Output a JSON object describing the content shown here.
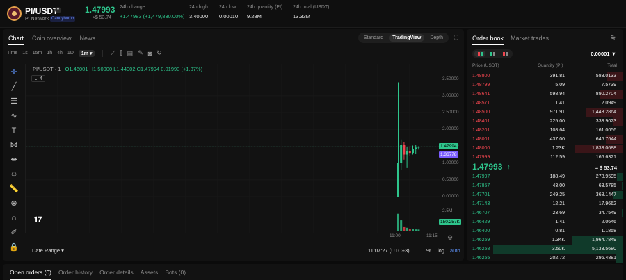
{
  "header": {
    "pair": "PI/USDT",
    "network": "PI Network",
    "network_tag": "Candybomb",
    "price": "1.47993",
    "fiat": "≈$ 53.74",
    "stats": [
      {
        "label": "24h change",
        "value": "+1.47983 (+1,479,830.00%)",
        "up": true
      },
      {
        "label": "24h high",
        "value": "3.40000"
      },
      {
        "label": "24h low",
        "value": "0.00010"
      },
      {
        "label": "24h quantity (PI)",
        "value": "9.28M"
      },
      {
        "label": "24h total (USDT)",
        "value": "13.33M"
      }
    ]
  },
  "chart_tabs": [
    "Chart",
    "Coin overview",
    "News"
  ],
  "view_modes": [
    "Standard",
    "TradingView",
    "Depth"
  ],
  "active_view": "TradingView",
  "timeframes": [
    "Time",
    "1s",
    "15m",
    "1h",
    "4h",
    "1D",
    "1m"
  ],
  "active_timeframe": "1m",
  "legend": {
    "symbol": "PI/USDT · 1",
    "open": "O1.46001",
    "high": "H1.50000",
    "low": "L1.44002",
    "close": "C1.47994",
    "change": "0.01993 (+1.37%)",
    "collapsed_count": "4"
  },
  "price_axis": [
    "3.50000",
    "3.00000",
    "2.50000",
    "2.00000",
    "1.50000",
    "1.00000",
    "0.50000",
    "0.00000"
  ],
  "volume_axis": [
    "2.5M"
  ],
  "price_tags": {
    "last": "1.47994",
    "mark": "1.36778",
    "volume": "150.257K"
  },
  "time_axis": [
    "11:00",
    "11:15"
  ],
  "bottom_bar": {
    "date_range": "Date Range",
    "clock": "11:07:27 (UTC+3)",
    "percent": "%",
    "log": "log",
    "auto": "auto"
  },
  "chart_data": {
    "type": "candlestick",
    "ylim": [
      0,
      3.7
    ],
    "candles": [
      {
        "o": 0.0001,
        "h": 3.4,
        "l": 0.0001,
        "c": 1.0
      },
      {
        "o": 1.0,
        "h": 1.7,
        "l": 0.8,
        "c": 1.55
      },
      {
        "o": 1.55,
        "h": 1.62,
        "l": 1.1,
        "c": 1.25
      },
      {
        "o": 1.25,
        "h": 1.48,
        "l": 0.85,
        "c": 1.35
      },
      {
        "o": 1.35,
        "h": 1.5,
        "l": 1.2,
        "c": 1.3
      },
      {
        "o": 1.3,
        "h": 1.52,
        "l": 1.25,
        "c": 1.42
      },
      {
        "o": 1.42,
        "h": 1.55,
        "l": 1.28,
        "c": 1.46
      },
      {
        "o": 1.46,
        "h": 1.5,
        "l": 1.4,
        "c": 1.48
      }
    ],
    "volumes": [
      2.6,
      1.6,
      0.65,
      0.45,
      0.25,
      0.3,
      0.2,
      0.18
    ],
    "volume_max": 3.0
  },
  "orderbook": {
    "tabs": [
      "Order book",
      "Market trades"
    ],
    "precision": "0.00001",
    "columns": [
      "Price (USDT)",
      "Quantity (PI)",
      "Total"
    ],
    "asks": [
      {
        "price": "1.48800",
        "qty": "391.81",
        "total": "583.0133",
        "depth": 0.1
      },
      {
        "price": "1.48799",
        "qty": "5.09",
        "total": "7.5739",
        "depth": 0
      },
      {
        "price": "1.48641",
        "qty": "598.94",
        "total": "890.2704",
        "depth": 0.15
      },
      {
        "price": "1.48571",
        "qty": "1.41",
        "total": "2.0949",
        "depth": 0
      },
      {
        "price": "1.48500",
        "qty": "971.91",
        "total": "1,443.2864",
        "depth": 0.24
      },
      {
        "price": "1.48401",
        "qty": "225.00",
        "total": "333.9023",
        "depth": 0.06
      },
      {
        "price": "1.48201",
        "qty": "108.64",
        "total": "161.0056",
        "depth": 0
      },
      {
        "price": "1.48001",
        "qty": "437.00",
        "total": "646.7644",
        "depth": 0.11
      },
      {
        "price": "1.48000",
        "qty": "1.23K",
        "total": "1,833.0688",
        "depth": 0.31
      },
      {
        "price": "1.47999",
        "qty": "112.59",
        "total": "166.6321",
        "depth": 0
      }
    ],
    "mid_price": "1.47993",
    "mid_arrow": "↑",
    "mid_fiat": "≈ $ 53.74",
    "bids": [
      {
        "price": "1.47997",
        "qty": "188.49",
        "total": "278.9595",
        "depth": 0.04
      },
      {
        "price": "1.47857",
        "qty": "43.00",
        "total": "63.5785",
        "depth": 0.01
      },
      {
        "price": "1.47701",
        "qty": "249.25",
        "total": "368.1447",
        "depth": 0.06
      },
      {
        "price": "1.47143",
        "qty": "12.21",
        "total": "17.9662",
        "depth": 0
      },
      {
        "price": "1.46707",
        "qty": "23.69",
        "total": "34.7549",
        "depth": 0.01
      },
      {
        "price": "1.46429",
        "qty": "1.41",
        "total": "2.0646",
        "depth": 0
      },
      {
        "price": "1.46400",
        "qty": "0.81",
        "total": "1.1858",
        "depth": 0
      },
      {
        "price": "1.46259",
        "qty": "1.34K",
        "total": "1,964.7849",
        "depth": 0.33
      },
      {
        "price": "1.46258",
        "qty": "3.50K",
        "total": "5,133.5680",
        "depth": 0.83
      },
      {
        "price": "1.46255",
        "qty": "202.72",
        "total": "296.4881",
        "depth": 0.05
      }
    ]
  },
  "order_tabs": [
    "Open orders (0)",
    "Order history",
    "Order details",
    "Assets",
    "Bots (0)"
  ],
  "colors": {
    "up": "#2ec58c",
    "down": "#f0454f",
    "accent": "#5b8def"
  }
}
